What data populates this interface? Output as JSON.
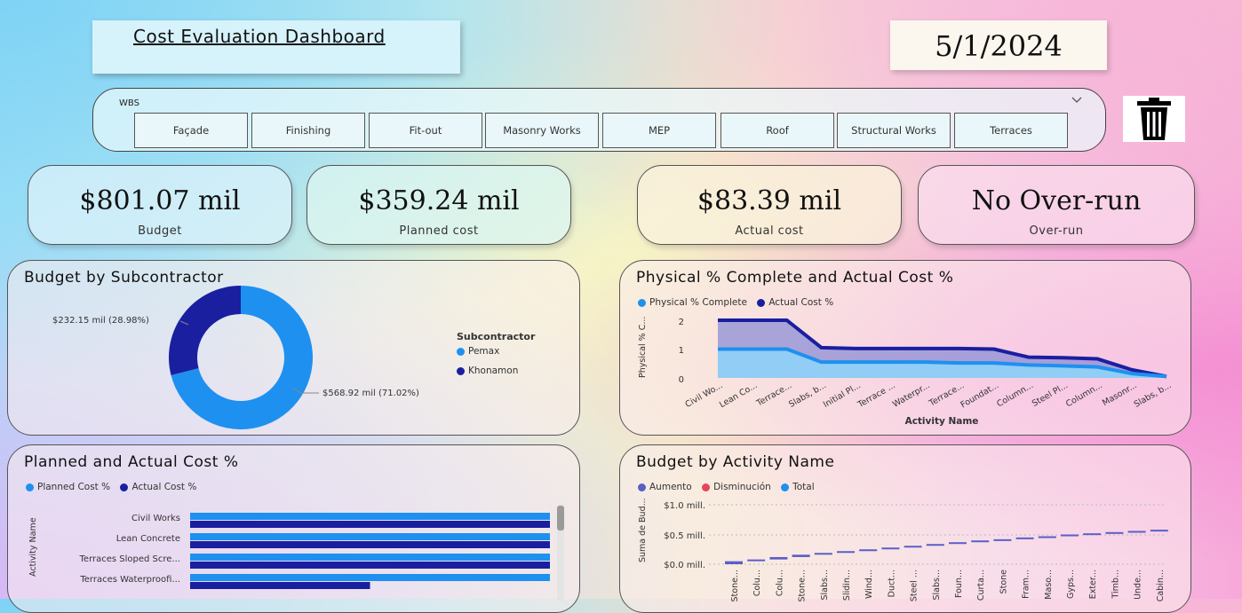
{
  "header": {
    "title": "Cost Evaluation Dashboard",
    "date": "5/1/2024"
  },
  "slicer": {
    "label": "WBS",
    "chevron": "chevron-down-icon",
    "options": [
      "Façade",
      "Finishing",
      "Fit-out",
      "Masonry Works",
      "MEP",
      "Roof",
      "Structural Works",
      "Terraces"
    ]
  },
  "clear_button": {
    "icon": "trash-icon"
  },
  "kpis": {
    "budget": {
      "value": "$801.07 mil",
      "label": "Budget"
    },
    "planned": {
      "value": "$359.24 mil",
      "label": "Planned cost"
    },
    "actual": {
      "value": "$83.39 mil",
      "label": "Actual cost"
    },
    "overrun": {
      "value": "No Over-run",
      "label": "Over-run"
    }
  },
  "colors": {
    "light_blue": "#1e90f0",
    "dark_blue": "#1a1fa0",
    "aumento": "#5b5fc7",
    "disminucion": "#e8445a",
    "total": "#1e90f0"
  },
  "budget_subcontractor": {
    "title": "Budget by Subcontractor",
    "legend_title": "Subcontractor",
    "legend": [
      "Pemax",
      "Khonamon"
    ],
    "label_khonamon": "$232.15 mil (28.98%)",
    "label_pemax": "$568.92 mil (71.02%)"
  },
  "physical_panel": {
    "title": "Physical % Complete and Actual Cost %",
    "legend": [
      "Physical % Complete",
      "Actual Cost %"
    ],
    "ylabel": "Physical % C...",
    "xlabel": "Activity Name",
    "yticks": [
      "2",
      "1",
      "0"
    ]
  },
  "planned_panel": {
    "title": "Planned and Actual Cost %",
    "legend": [
      "Planned Cost %",
      "Actual Cost %"
    ],
    "ylabel": "Activity Name"
  },
  "activity_panel": {
    "title": "Budget by Activity Name",
    "legend": [
      "Aumento",
      "Disminución",
      "Total"
    ],
    "ylabel": "Suma de Bud...",
    "yticks": [
      "$1.0 mill.",
      "$0.5 mill.",
      "$0.0 mill."
    ]
  },
  "chart_data": [
    {
      "type": "pie",
      "title": "Budget by Subcontractor",
      "categories": [
        "Pemax",
        "Khonamon"
      ],
      "values": [
        568.92,
        232.15
      ],
      "percent": [
        71.02,
        28.98
      ],
      "unit": "mil"
    },
    {
      "type": "area",
      "title": "Physical % Complete and Actual Cost %",
      "xlabel": "Activity Name",
      "ylabel": "Physical % C...",
      "ylim": [
        0,
        2
      ],
      "categories": [
        "Civil Wo...",
        "Lean Co...",
        "Terrace...",
        "Slabs, b...",
        "Initial Pl...",
        "Terrace ...",
        "Waterpr...",
        "Terrace...",
        "Foundat...",
        "Column...",
        "Steel Pl...",
        "Column...",
        "Masonr...",
        "Slabs, b..."
      ],
      "series": [
        {
          "name": "Physical % Complete",
          "values": [
            1.0,
            1.0,
            1.0,
            0.55,
            0.55,
            0.55,
            0.55,
            0.52,
            0.52,
            0.45,
            0.42,
            0.38,
            0.15,
            0.05
          ]
        },
        {
          "name": "Actual Cost %",
          "values": [
            2.0,
            2.0,
            2.0,
            1.05,
            1.02,
            1.02,
            1.02,
            1.02,
            1.0,
            0.72,
            0.7,
            0.66,
            0.28,
            0.05
          ]
        }
      ]
    },
    {
      "type": "bar",
      "title": "Planned and Actual Cost %",
      "ylabel": "Activity Name",
      "categories": [
        "Civil Works",
        "Lean Concrete",
        "Terraces Sloped Scre...",
        "Terraces Waterproofi..."
      ],
      "series": [
        {
          "name": "Planned Cost %",
          "values": [
            1.0,
            1.0,
            1.0,
            1.0
          ]
        },
        {
          "name": "Actual Cost %",
          "values": [
            1.0,
            1.0,
            1.0,
            0.5
          ]
        }
      ]
    },
    {
      "type": "bar",
      "title": "Budget by Activity Name",
      "ylabel": "Suma de Bud...",
      "ylim": [
        0,
        1.0
      ],
      "categories": [
        "Stone...",
        "Colu...",
        "Colu...",
        "Stone...",
        "Slabs...",
        "Slidin...",
        "Wind...",
        "Duct...",
        "Steel ...",
        "Slabs...",
        "Foun...",
        "Curta...",
        "Stone",
        "Fram...",
        "Maso...",
        "Gyps...",
        "Exter...",
        "Timb...",
        "Unde...",
        "Cabin..."
      ],
      "series": [
        {
          "name": "Aumento",
          "values": [
            0.05,
            0.08,
            0.12,
            0.16,
            0.19,
            0.22,
            0.25,
            0.28,
            0.31,
            0.34,
            0.37,
            0.4,
            0.42,
            0.45,
            0.47,
            0.5,
            0.52,
            0.54,
            0.56,
            0.58
          ]
        }
      ]
    }
  ]
}
